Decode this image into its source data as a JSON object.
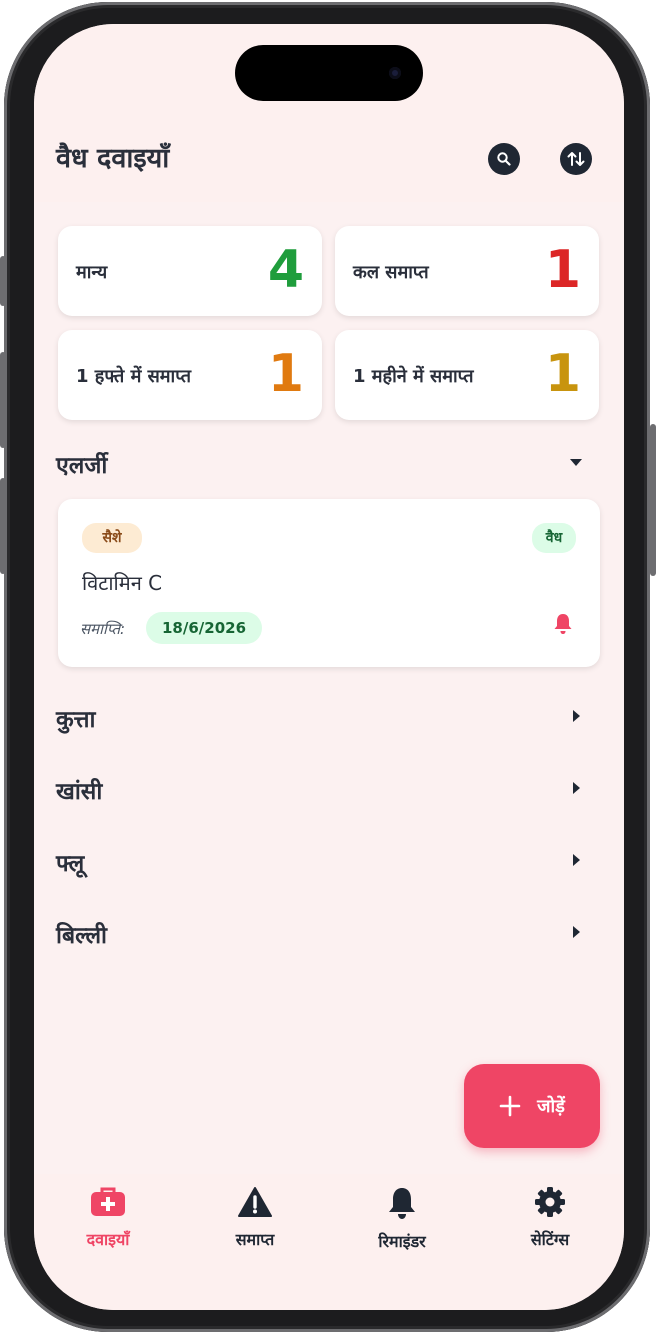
{
  "header": {
    "title": "वैध दवाइयाँ",
    "search_icon": "search-icon",
    "sort_icon": "sort-arrows-icon"
  },
  "stats": [
    {
      "label": "मान्य",
      "value": "4",
      "color": "#1f9d3c"
    },
    {
      "label": "कल समाप्त",
      "value": "1",
      "color": "#dc2626"
    },
    {
      "label": "1 हफ्ते में समाप्त",
      "value": "1",
      "color": "#e07a10"
    },
    {
      "label": "1 महीने में समाप्त",
      "value": "1",
      "color": "#c8940e"
    }
  ],
  "groups": [
    {
      "title": "एलर्जी",
      "expanded": true
    },
    {
      "title": "कुत्ता",
      "expanded": false
    },
    {
      "title": "खांसी",
      "expanded": false
    },
    {
      "title": "फ्लू",
      "expanded": false
    },
    {
      "title": "बिल्ली",
      "expanded": false
    }
  ],
  "medicine_card": {
    "form_badge": "सैशे",
    "status_badge": "वैध",
    "name": "विटामिन C",
    "expiry_label": "समाप्ति:",
    "expiry_date": "18/6/2026",
    "reminder_icon": "bell-icon"
  },
  "fab": {
    "icon": "plus-icon",
    "label": "जोड़ें"
  },
  "tabs": [
    {
      "label": "दवाइयाँ",
      "icon": "medical-kit-icon",
      "active": true
    },
    {
      "label": "समाप्त",
      "icon": "warning-icon",
      "active": false
    },
    {
      "label": "रिमाइंडर",
      "icon": "bell-icon",
      "active": false
    },
    {
      "label": "सेटिंग्स",
      "icon": "gear-icon",
      "active": false
    }
  ],
  "colors": {
    "accent": "#ef4565",
    "dark": "#1f2733",
    "background": "#fcf1f1"
  }
}
